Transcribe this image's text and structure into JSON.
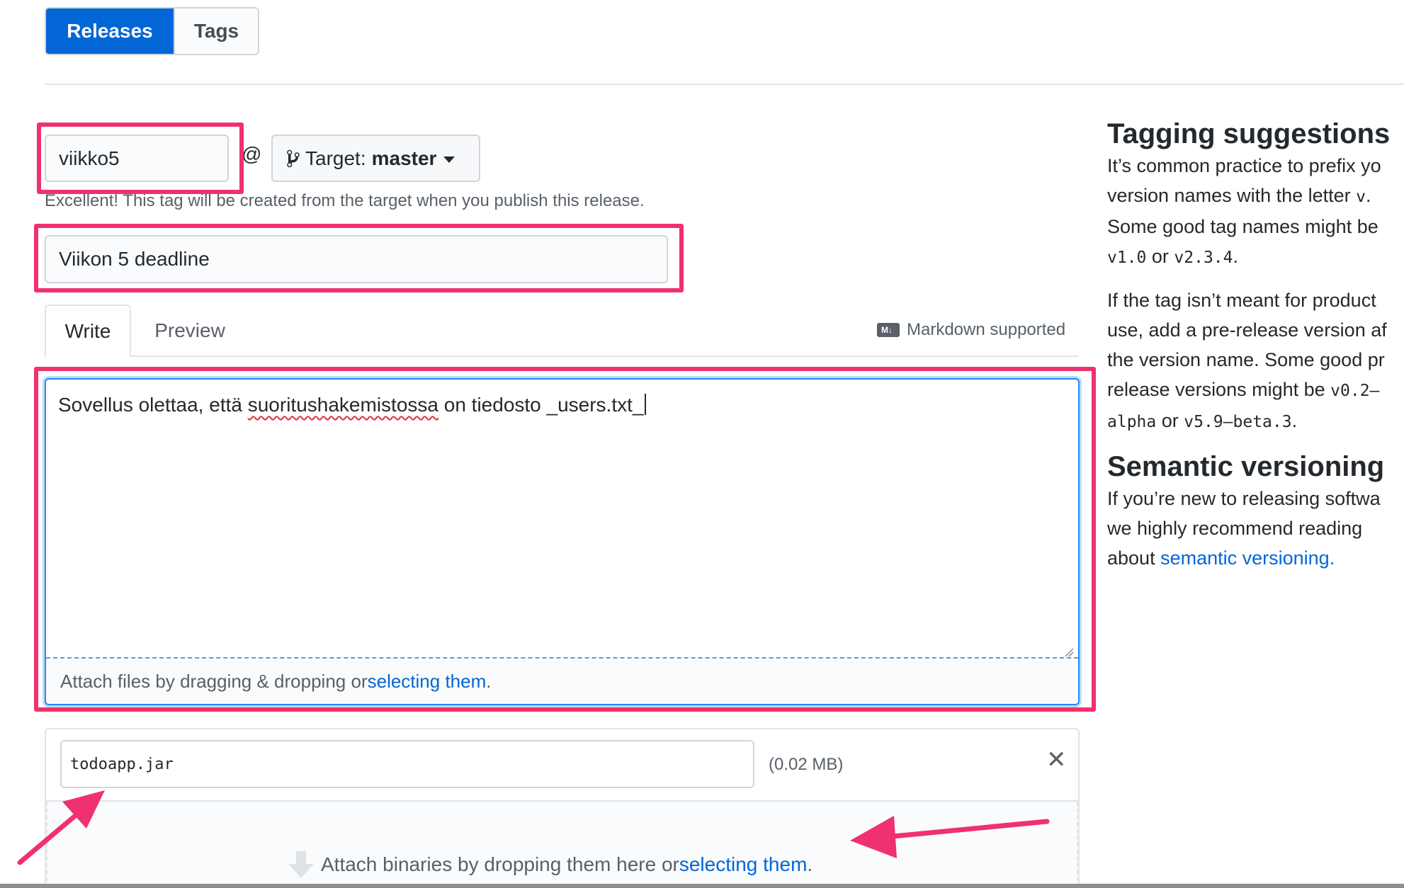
{
  "tabs": {
    "releases": "Releases",
    "tags": "Tags"
  },
  "tag": {
    "value": "viikko5",
    "at": "@",
    "target_prefix": "Target:",
    "target_branch": "master",
    "hint": "Excellent! This tag will be created from the target when you publish this release."
  },
  "release_title": {
    "value": "Viikon 5 deadline"
  },
  "editor_tabs": {
    "write": "Write",
    "preview": "Preview",
    "markdown_hint": "Markdown supported",
    "markdown_logo": "M↓"
  },
  "editor": {
    "text_before": "Sovellus olettaa, että ",
    "text_misspelled": "suoritushakemistossa",
    "text_after": " on tiedosto _users.txt_",
    "attach_text": "Attach files by dragging & dropping or ",
    "attach_link": "selecting them",
    "attach_end": "."
  },
  "binaries": {
    "file_name": "todoapp.jar",
    "file_size": "(0.02 MB)",
    "close": "✕",
    "drop_text": "Attach binaries by dropping them here or ",
    "drop_link": "selecting them",
    "drop_end": "."
  },
  "sidebar": {
    "tagging_title": "Tagging suggestions",
    "p1_l1": "It’s common practice to prefix yo",
    "p1_l2a": "version names with the letter ",
    "p1_l2code": "v",
    "p1_l2b": ".",
    "p1_l3": "Some good tag names might be",
    "p1_l4code1": "v1.0",
    "p1_l4mid": " or ",
    "p1_l4code2": "v2.3.4",
    "p1_l4end": ".",
    "p2_l1": "If the tag isn’t meant for product",
    "p2_l2": "use, add a pre-release version af",
    "p2_l3": "the version name. Some good pr",
    "p2_l4a": "release versions might be ",
    "p2_l4code": "v0.2–",
    "p2_l5code1": "alpha",
    "p2_l5mid": " or ",
    "p2_l5code2": "v5.9–beta.3",
    "p2_l5end": ".",
    "semver_title": "Semantic versioning",
    "p3_l1": "If you’re new to releasing softwa",
    "p3_l2": "we highly recommend reading",
    "p3_l3a": "about ",
    "p3_l3link": "semantic versioning."
  },
  "colors": {
    "accent": "#0366d6",
    "highlight": "#f0316f",
    "focus": "#2188ff"
  }
}
